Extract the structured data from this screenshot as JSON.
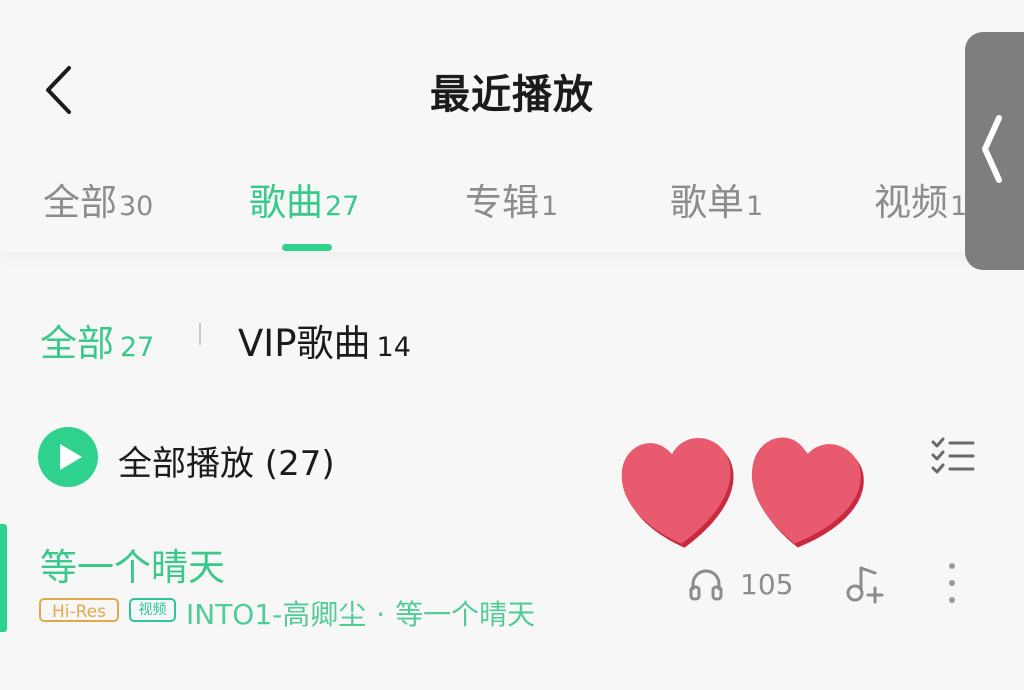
{
  "header": {
    "title": "最近播放",
    "back_icon": "chevron-left-icon"
  },
  "tabs": [
    {
      "label": "全部",
      "count": "30",
      "active": false
    },
    {
      "label": "歌曲",
      "count": "27",
      "active": true
    },
    {
      "label": "专辑",
      "count": "1",
      "active": false
    },
    {
      "label": "歌单",
      "count": "1",
      "active": false
    },
    {
      "label": "视频",
      "count": "1",
      "active": false
    }
  ],
  "filters": {
    "all": {
      "label": "全部",
      "count": "27"
    },
    "vip": {
      "label": "VIP歌曲",
      "count": "14"
    }
  },
  "play_all": {
    "label": "全部播放 (27)"
  },
  "song": {
    "title": "等一个晴天",
    "badges": [
      "Hi-Res",
      "视频"
    ],
    "artist": "INTO1-高卿尘",
    "separator": "·",
    "album": "等一个晴天",
    "listen_count": "105"
  },
  "colors": {
    "accent": "#2ed28e",
    "hires": "#e2a84a",
    "heart": "#e85a6e"
  }
}
